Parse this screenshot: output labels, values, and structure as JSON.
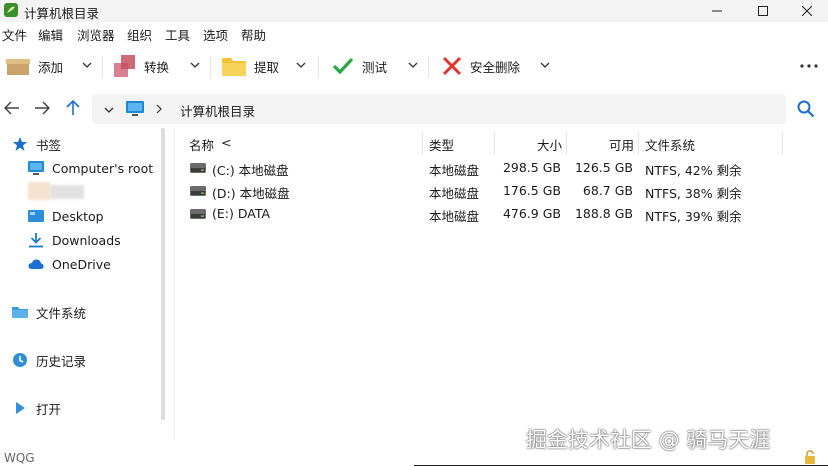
{
  "window": {
    "title": "计算机根目录"
  },
  "menu": [
    "文件",
    "编辑",
    "浏览器",
    "组织",
    "工具",
    "选项",
    "帮助"
  ],
  "toolbar": {
    "add": "添加",
    "convert": "转换",
    "extract": "提取",
    "test": "测试",
    "secure_delete": "安全删除"
  },
  "address": {
    "path": "计算机根目录"
  },
  "sidebar": {
    "bookmarks": "书签",
    "items": [
      "Computer's root",
      "Desktop",
      "Downloads",
      "OneDrive"
    ],
    "filesystem": "文件系统",
    "history": "历史记录",
    "open": "打开"
  },
  "columns": {
    "name": "名称",
    "sort_marker": "<",
    "type": "类型",
    "size": "大小",
    "free": "可用",
    "filesystem": "文件系统"
  },
  "drives": [
    {
      "name": "(C:) 本地磁盘",
      "type": "本地磁盘",
      "size": "298.5 GB",
      "free": "126.5 GB",
      "fs": "NTFS, 42% 剩余"
    },
    {
      "name": "(D:) 本地磁盘",
      "type": "本地磁盘",
      "size": "176.5 GB",
      "free": "68.7 GB",
      "fs": "NTFS, 38% 剩余"
    },
    {
      "name": "(E:) DATA",
      "type": "本地磁盘",
      "size": "476.9 GB",
      "free": "188.8 GB",
      "fs": "NTFS, 39% 剩余"
    }
  ],
  "status": {
    "left": "WQG"
  },
  "watermark": "掘金技术社区 @ 骑马天涯"
}
